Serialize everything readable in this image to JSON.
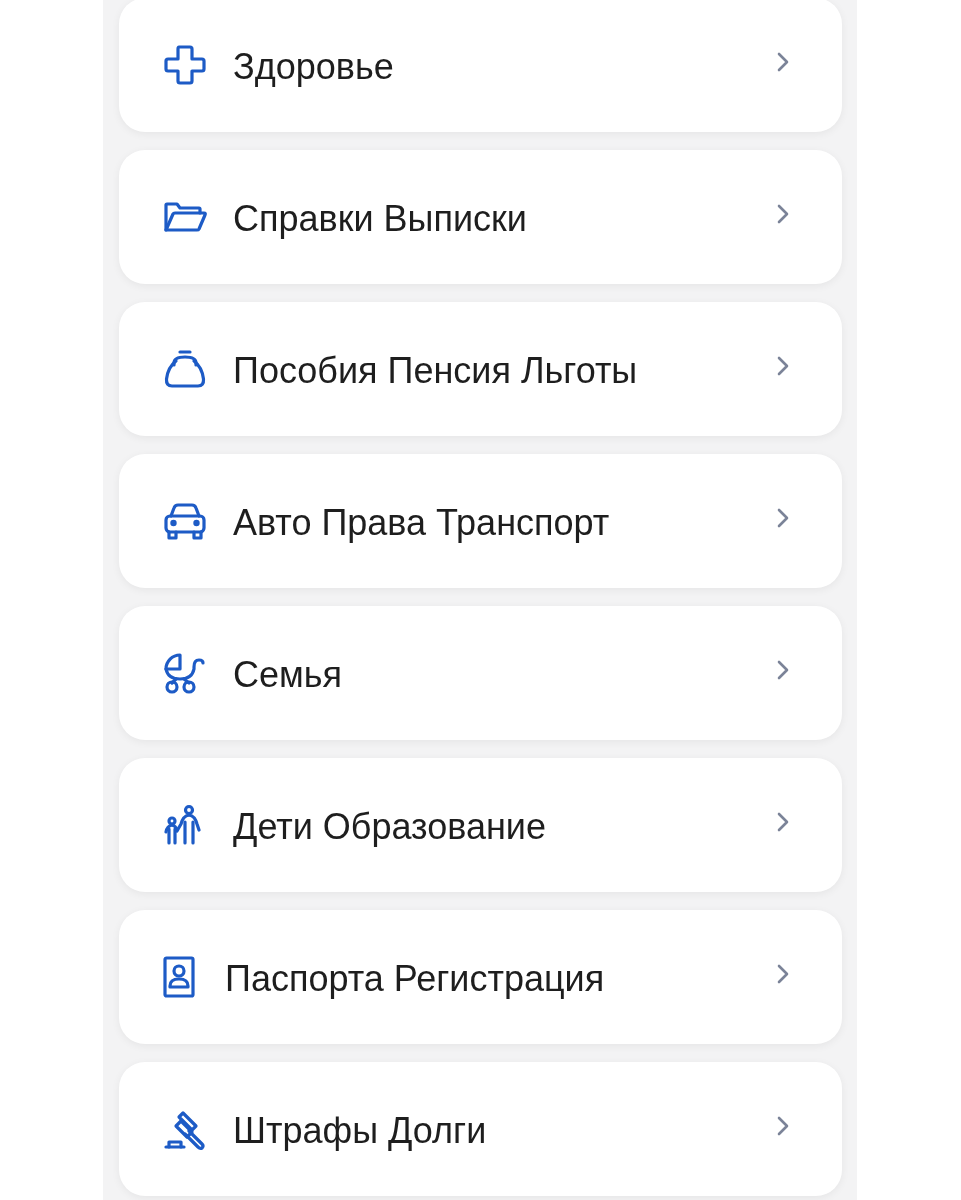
{
  "items": [
    {
      "label": "Здоровье",
      "kind": "cross"
    },
    {
      "label": "Справки Выписки",
      "kind": "folder"
    },
    {
      "label": "Пособия Пенсия Льготы",
      "kind": "purse"
    },
    {
      "label": "Авто Права Транспорт",
      "kind": "car"
    },
    {
      "label": "Семья",
      "kind": "stroller"
    },
    {
      "label": "Дети Образование",
      "kind": "kids"
    },
    {
      "label": "Паспорта Регистрация",
      "kind": "passport"
    },
    {
      "label": "Штрафы Долги",
      "kind": "gavel"
    }
  ]
}
